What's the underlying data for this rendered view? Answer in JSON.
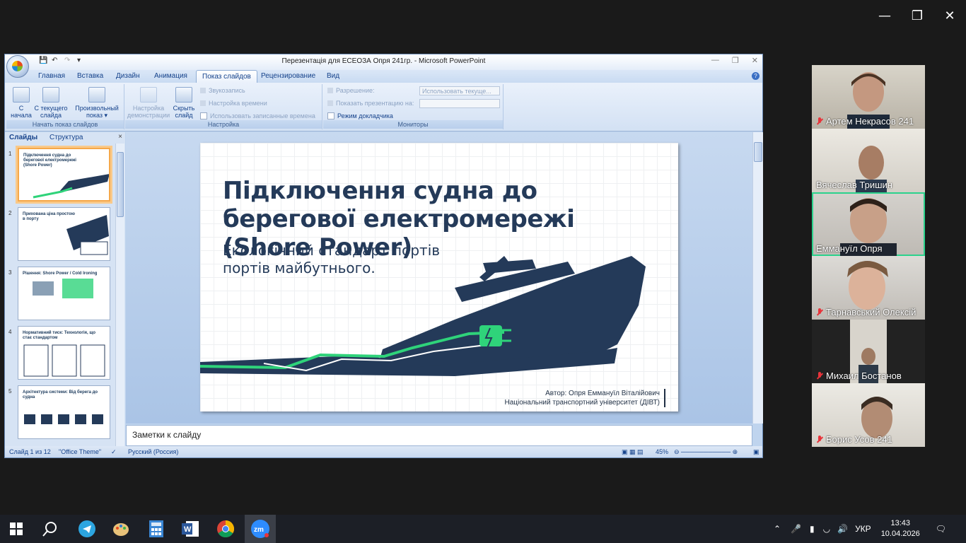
{
  "window": {
    "title": "Перезентація для ЕСЕОЗА Опря 241гр. - Microsoft PowerPoint"
  },
  "tabs": [
    "Главная",
    "Вставка",
    "Дизайн",
    "Анимация",
    "Показ слайдов",
    "Рецензирование",
    "Вид"
  ],
  "active_tab": "Показ слайдов",
  "ribbon": {
    "start_group": {
      "label": "Начать показ слайдов",
      "from_start": "С начала",
      "from_current": "С текущего слайда",
      "custom": "Произвольный показ"
    },
    "setup_group": {
      "label": "Настройка",
      "setup": "Настройка демонстрации",
      "hide": "Скрыть слайд",
      "record": "Звукозапись",
      "rehearse": "Настройка времени",
      "use_timings": "Использовать записанные времена"
    },
    "monitors_group": {
      "label": "Мониторы",
      "resolution": "Разрешение:",
      "resolution_value": "Использовать текуще...",
      "show_on": "Показать презентацию на:",
      "presenter": "Режим докладчика"
    }
  },
  "panel": {
    "tab_slides": "Слайды",
    "tab_outline": "Структура",
    "close": "×"
  },
  "thumbnails": [
    {
      "num": "1",
      "title": "Підключення судна до берегової електромережі (Shore Power)"
    },
    {
      "num": "2",
      "title": "Прихована ціна простою в порту"
    },
    {
      "num": "3",
      "title": "Рішення: Shore Power / Cold Ironing"
    },
    {
      "num": "4",
      "title": "Нормативний тиск: Технологія, що стає стандартом"
    },
    {
      "num": "5",
      "title": "Архітектура системи: Від берега до судна"
    }
  ],
  "slide": {
    "title": "Підключення судна до берегової електромережі (Shore Power)",
    "subtitle": "Екологічний стандарт портів портів майбутнього.",
    "author_line1": "Автор: Опря Еммануїл Віталійович",
    "author_line2": "Національний транспортний університет (ДІВТ)"
  },
  "notes": {
    "placeholder": "Заметки к слайду"
  },
  "status": {
    "slide": "Слайд 1 из 12",
    "theme": "\"Office Theme\"",
    "lang": "Русский (Россия)",
    "zoom": "45%"
  },
  "participants": [
    {
      "name": "Артем Некрасов 241",
      "muted": true
    },
    {
      "name": "Вячеслав Тришин",
      "muted": false
    },
    {
      "name": "Еммануїл Опря",
      "muted": false,
      "active": true
    },
    {
      "name": "Тарнавський Олексій",
      "muted": true
    },
    {
      "name": "Михаил Бостанов",
      "muted": true
    },
    {
      "name": "Борис Усов 241",
      "muted": true
    }
  ],
  "taskbar": {
    "lang": "УКР",
    "time": "13:43",
    "date": "10.04.2026"
  },
  "colors": {
    "navy": "#243a59",
    "green": "#2fd37a",
    "accent": "#2bd28c"
  }
}
